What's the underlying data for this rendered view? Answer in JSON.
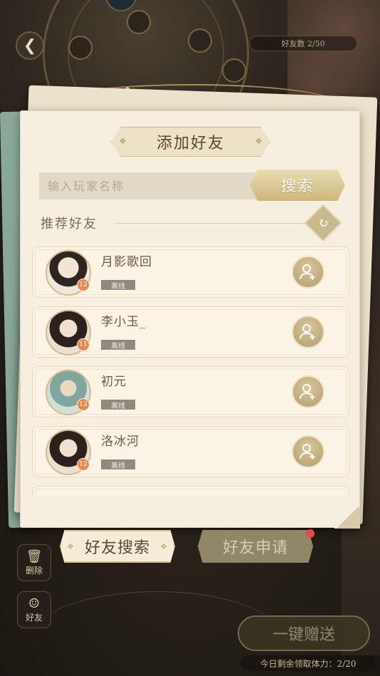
{
  "dialog": {
    "title": "添加好友",
    "search_placeholder": "输入玩家名称",
    "search_button": "搜索",
    "recommend_label": "推荐好友"
  },
  "friends": [
    {
      "name": "月影歌回",
      "status": "离线",
      "level": "12"
    },
    {
      "name": "李小玉_",
      "status": "离线",
      "level": "11"
    },
    {
      "name": "初元",
      "status": "离线",
      "level": "12"
    },
    {
      "name": "洛冰河",
      "status": "离线",
      "level": "12"
    }
  ],
  "tabs": {
    "search": "好友搜索",
    "requests": "好友申请"
  },
  "background": {
    "top_pill": "好友数 2/50",
    "side_delete": "删除",
    "side_friends": "好友",
    "gift_all": "一键赠送",
    "stamina": "今日剩余领取体力：2/20"
  },
  "colors": {
    "accent_gold": "#cdb77d",
    "dialog_bg": "#f6efe0",
    "status_offline": "#8e8a7e",
    "notification": "#e84a3e"
  }
}
